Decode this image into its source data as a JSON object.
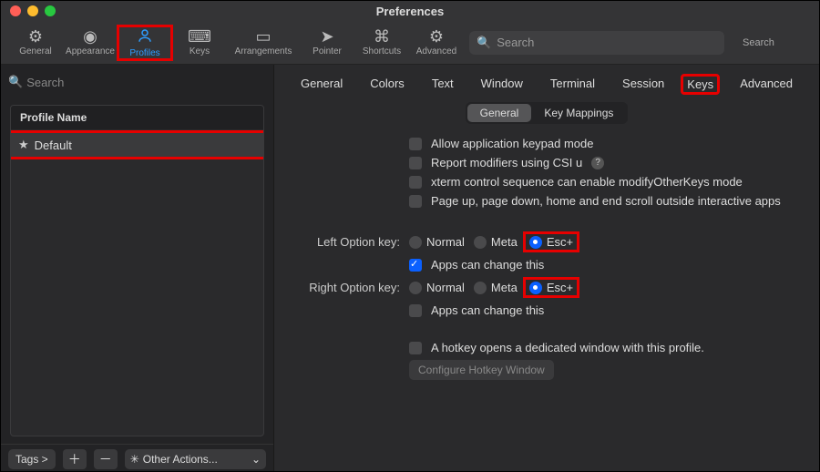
{
  "window": {
    "title": "Preferences"
  },
  "toolbar": {
    "items": [
      {
        "label": "General"
      },
      {
        "label": "Appearance"
      },
      {
        "label": "Profiles"
      },
      {
        "label": "Keys"
      },
      {
        "label": "Arrangements"
      },
      {
        "label": "Pointer"
      },
      {
        "label": "Shortcuts"
      },
      {
        "label": "Advanced"
      }
    ],
    "search_placeholder": "Search",
    "search_label": "Search"
  },
  "sidebar": {
    "search_placeholder": "Search",
    "header": "Profile Name",
    "profile_default": "Default",
    "tags_btn": "Tags >",
    "other_actions": "Other Actions..."
  },
  "tabs": {
    "items": [
      "General",
      "Colors",
      "Text",
      "Window",
      "Terminal",
      "Session",
      "Keys",
      "Advanced"
    ],
    "sub": {
      "general": "General",
      "keymap": "Key Mappings"
    }
  },
  "form": {
    "allow_keypad": "Allow application keypad mode",
    "report_csi": "Report modifiers using CSI u",
    "xterm_modify": "xterm control sequence can enable modifyOtherKeys mode",
    "pagescroll": "Page up, page down, home and end scroll outside interactive apps",
    "left_opt_label": "Left Option key:",
    "right_opt_label": "Right Option key:",
    "opt_normal": "Normal",
    "opt_meta": "Meta",
    "opt_esc": "Esc+",
    "apps_change": "Apps can change this",
    "hotkey": "A hotkey opens a dedicated window with this profile.",
    "config_hotkey": "Configure Hotkey Window"
  }
}
